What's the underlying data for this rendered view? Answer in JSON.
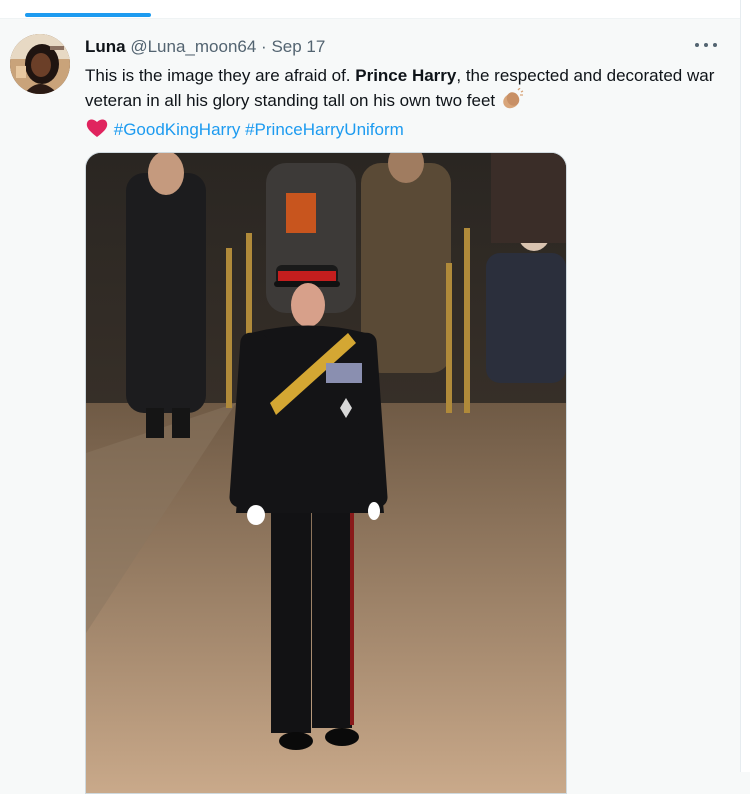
{
  "tweet": {
    "author_name": "Luna",
    "handle": "@Luna_moon64",
    "separator": "·",
    "date": "Sep 17",
    "text_part1": "This is the image they are afraid of. ",
    "text_bold": "Prince Harry",
    "text_part2": ", the respected and decorated war veteran in all his glory standing tall on his own two feet ",
    "hashtag1": "#GoodKingHarry",
    "hashtag2": "#PrinceHarryUniform",
    "emojis": [
      "clapping-hands",
      "red-heart"
    ]
  },
  "colors": {
    "accent": "#1d9bf0",
    "text": "#0f1419",
    "muted": "#536471",
    "heart": "#e0245e"
  }
}
